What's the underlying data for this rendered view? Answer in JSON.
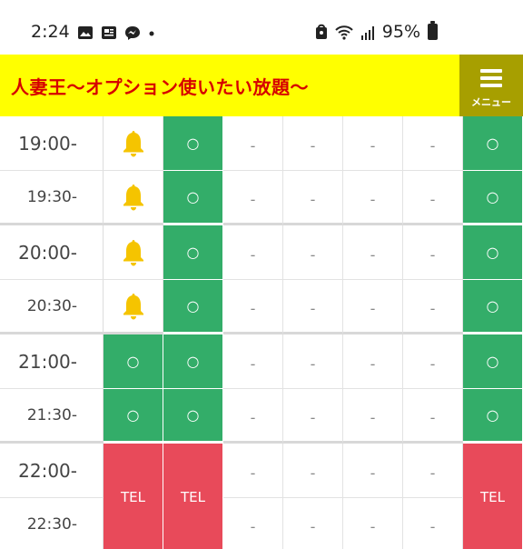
{
  "status_bar": {
    "time": "2:24",
    "battery": "95%",
    "icons": [
      "image-icon",
      "news-icon",
      "messenger-icon",
      "dot-icon",
      "bag-icon",
      "wifi-icon",
      "signal-icon",
      "battery-icon"
    ]
  },
  "header": {
    "title": "人妻王〜オプション使いたい放題〜",
    "menu_label": "メニュー",
    "colors": {
      "bar": "#ffff00",
      "title": "#d60000",
      "menu": "#a79f00"
    }
  },
  "schedule": {
    "times": [
      "19:00-",
      "19:30-",
      "20:00-",
      "20:30-",
      "21:00-",
      "21:30-",
      "22:00-",
      "22:30-"
    ],
    "available_mark": "○",
    "none_mark": "-",
    "tel_label": "TEL",
    "colors": {
      "available": "#33ad69",
      "tel": "#e84a5a",
      "bell": "#f5c400"
    },
    "columns": [
      [
        "bell",
        "bell",
        "bell",
        "bell",
        "avail",
        "avail",
        "tel",
        "tel"
      ],
      [
        "avail",
        "avail",
        "avail",
        "avail",
        "avail",
        "avail",
        "tel",
        "tel"
      ],
      [
        "none",
        "none",
        "none",
        "none",
        "none",
        "none",
        "none",
        "none"
      ],
      [
        "none",
        "none",
        "none",
        "none",
        "none",
        "none",
        "none",
        "none"
      ],
      [
        "none",
        "none",
        "none",
        "none",
        "none",
        "none",
        "none",
        "none"
      ],
      [
        "none",
        "none",
        "none",
        "none",
        "none",
        "none",
        "none",
        "none"
      ],
      [
        "avail",
        "avail",
        "avail",
        "avail",
        "avail",
        "avail",
        "tel",
        "tel"
      ]
    ]
  }
}
